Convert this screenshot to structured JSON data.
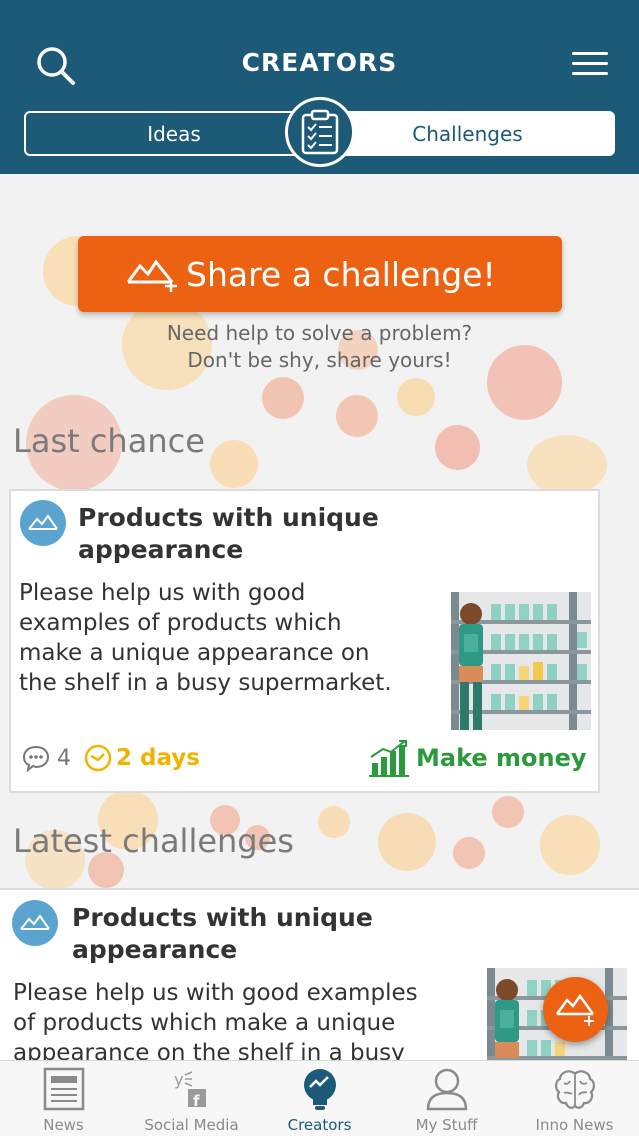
{
  "header": {
    "logo": "CREATORS",
    "tabs": [
      {
        "label": "Ideas"
      },
      {
        "label": "Challenges"
      }
    ]
  },
  "cta": {
    "label": "Share a challenge!",
    "help_line1": "Need help to solve a problem?",
    "help_line2": "Don't be shy, share yours!"
  },
  "sections": {
    "last_chance": "Last chance",
    "latest": "Latest challenges"
  },
  "last_chance_card": {
    "title_line1": "Products with unique",
    "title_line2": "appearance",
    "desc_lines": [
      "Please help us with good",
      "examples of products which",
      "make a unique appearance on",
      "the shelf in a busy supermarket."
    ],
    "comments": "4",
    "time_left": "2 days",
    "reward": "Make money"
  },
  "latest_card": {
    "title_line1": "Products with unique",
    "title_line2": "appearance",
    "desc_lines": [
      "Please help us with good examples",
      "of products which make a unique",
      "appearance on the shelf in a busy"
    ]
  },
  "bottom_nav": [
    {
      "label": "News"
    },
    {
      "label": "Social Media"
    },
    {
      "label": "Creators"
    },
    {
      "label": "My Stuff"
    },
    {
      "label": "Inno News"
    }
  ],
  "colors": {
    "header": "#1d5a77",
    "accent": "#ec6212",
    "time": "#f0b400",
    "reward": "#2a9a3a",
    "icon_blue": "#5ba4cf"
  }
}
